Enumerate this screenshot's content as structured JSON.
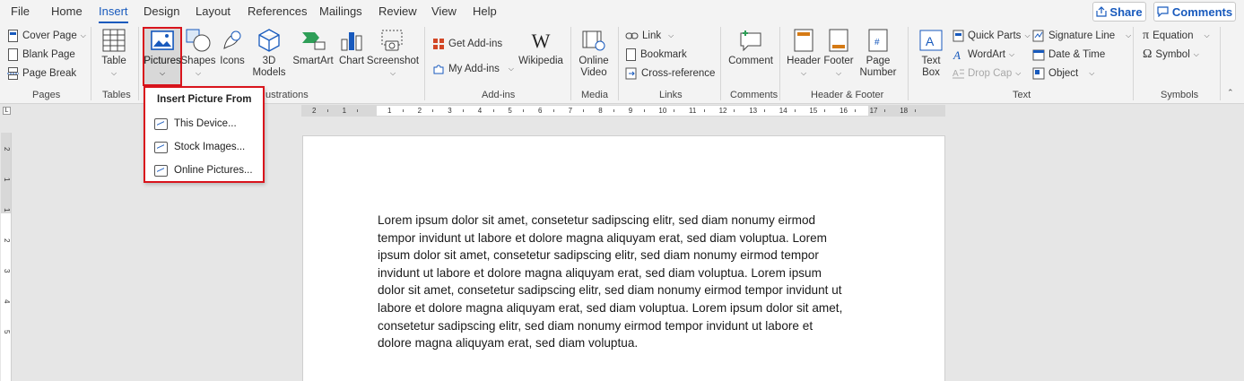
{
  "menu": {
    "tabs": [
      "File",
      "Home",
      "Insert",
      "Design",
      "Layout",
      "References",
      "Mailings",
      "Review",
      "View",
      "Help"
    ],
    "active_tab": "Insert",
    "share_label": "Share",
    "comments_label": "Comments"
  },
  "ribbon": {
    "pages": {
      "cover_page": "Cover Page",
      "blank_page": "Blank Page",
      "page_break": "Page Break",
      "group": "Pages"
    },
    "tables": {
      "table": "Table",
      "group": "Tables"
    },
    "illustrations": {
      "pictures": "Pictures",
      "shapes": "Shapes",
      "icons": "Icons",
      "models_3d_1": "3D",
      "models_3d_2": "Models",
      "smartart": "SmartArt",
      "chart": "Chart",
      "screenshot": "Screenshot",
      "group": "Illustrations",
      "group_visible": "ustrations"
    },
    "addins": {
      "get_addins": "Get Add-ins",
      "my_addins": "My Add-ins",
      "wikipedia": "Wikipedia",
      "group": "Add-ins"
    },
    "media": {
      "online_video_1": "Online",
      "online_video_2": "Video",
      "group": "Media"
    },
    "links": {
      "link": "Link",
      "bookmark": "Bookmark",
      "cross_reference": "Cross-reference",
      "group": "Links"
    },
    "comments": {
      "comment": "Comment",
      "group": "Comments"
    },
    "header_footer": {
      "header": "Header",
      "footer": "Footer",
      "page_number_1": "Page",
      "page_number_2": "Number",
      "group": "Header & Footer"
    },
    "text": {
      "text_box_1": "Text",
      "text_box_2": "Box",
      "quick_parts": "Quick Parts",
      "wordart": "WordArt",
      "drop_cap": "Drop Cap",
      "signature_line": "Signature Line",
      "date_time": "Date & Time",
      "object": "Object",
      "group": "Text"
    },
    "symbols": {
      "equation": "Equation",
      "symbol": "Symbol",
      "group": "Symbols"
    }
  },
  "dropdown": {
    "title": "Insert Picture From",
    "items": [
      "This Device...",
      "Stock Images...",
      "Online Pictures..."
    ]
  },
  "ruler": {
    "h_numbers": [
      "2",
      "1",
      "1",
      "2",
      "3",
      "4",
      "5",
      "6",
      "7",
      "8",
      "9",
      "10",
      "11",
      "12",
      "13",
      "14",
      "15",
      "16",
      "17",
      "18"
    ],
    "v_numbers": [
      "2",
      "1",
      "1",
      "2",
      "3",
      "4",
      "5"
    ]
  },
  "document": {
    "lines": [
      "Lorem ipsum dolor sit amet, consetetur sadipscing elitr, sed diam nonumy eirmod",
      "tempor invidunt ut labore et dolore magna aliquyam erat, sed diam voluptua. Lorem",
      "ipsum dolor sit amet, consetetur sadipscing elitr, sed diam nonumy eirmod tempor",
      "invidunt ut labore et dolore magna aliquyam erat, sed diam voluptua. Lorem ipsum",
      "dolor sit amet, consetetur sadipscing elitr, sed diam nonumy eirmod tempor invidunt ut",
      "labore et dolore magna aliquyam erat, sed diam voluptua. Lorem ipsum dolor sit amet,",
      "consetetur sadipscing elitr, sed diam nonumy eirmod tempor invidunt ut labore et",
      "dolore magna aliquyam erat, sed diam voluptua."
    ]
  },
  "colors": {
    "accent": "#185abd",
    "highlight": "#d9141c"
  }
}
